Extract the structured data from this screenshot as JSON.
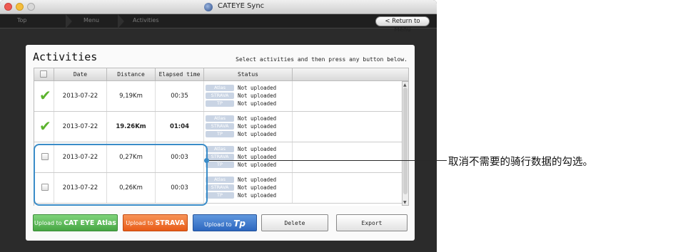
{
  "window": {
    "title": "CATEYE Sync"
  },
  "nav": {
    "crumbs": [
      "Top",
      "Menu",
      "Activities"
    ],
    "return_label": "< Return to Menu"
  },
  "activities": {
    "heading": "Activities",
    "instruction": "Select activities and then press any button below.",
    "columns": [
      "Date",
      "Distance",
      "Elapsed time",
      "Status"
    ],
    "rows": [
      {
        "checked": true,
        "date": "2013-07-22",
        "distance": "9,19Km",
        "elapsed": "00:35",
        "status": [
          {
            "service": "Atlas",
            "text": "Not uploaded"
          },
          {
            "service": "STRAVA",
            "text": "Not uploaded"
          },
          {
            "service": "TP",
            "text": "Not uploaded"
          }
        ]
      },
      {
        "checked": true,
        "date": "2013-07-22",
        "distance": "19.26Km",
        "elapsed": "01:04",
        "status": [
          {
            "service": "Atlas",
            "text": "Not uploaded"
          },
          {
            "service": "STRAVA",
            "text": "Not uploaded"
          },
          {
            "service": "TP",
            "text": "Not uploaded"
          }
        ]
      },
      {
        "checked": false,
        "date": "2013-07-22",
        "distance": "0,27Km",
        "elapsed": "00:03",
        "status": [
          {
            "service": "Atlas",
            "text": "Not uploaded"
          },
          {
            "service": "STRAVA",
            "text": "Not uploaded"
          },
          {
            "service": "TP",
            "text": "Not uploaded"
          }
        ]
      },
      {
        "checked": false,
        "date": "2013-07-22",
        "distance": "0,26Km",
        "elapsed": "00:03",
        "status": [
          {
            "service": "Atlas",
            "text": "Not uploaded"
          },
          {
            "service": "STRAVA",
            "text": "Not uploaded"
          },
          {
            "service": "TP",
            "text": "Not uploaded"
          }
        ]
      }
    ]
  },
  "buttons": {
    "upload_cateye_prefix": "Upload to",
    "upload_cateye_brand": "CAT EYE Atlas",
    "upload_strava_prefix": "Upload to",
    "upload_strava_brand": "STRAVA",
    "upload_tp_prefix": "Upload to",
    "upload_tp_brand": "Tp",
    "delete": "Delete",
    "export": "Export"
  },
  "annotation": {
    "caption": "取消不需要的骑行数据的勾选。"
  },
  "colors": {
    "highlight": "#3a8cc8",
    "check": "#5cb32e",
    "cateye_button": "#47a643",
    "strava_button": "#e85b17",
    "tp_button": "#2d67bf"
  }
}
